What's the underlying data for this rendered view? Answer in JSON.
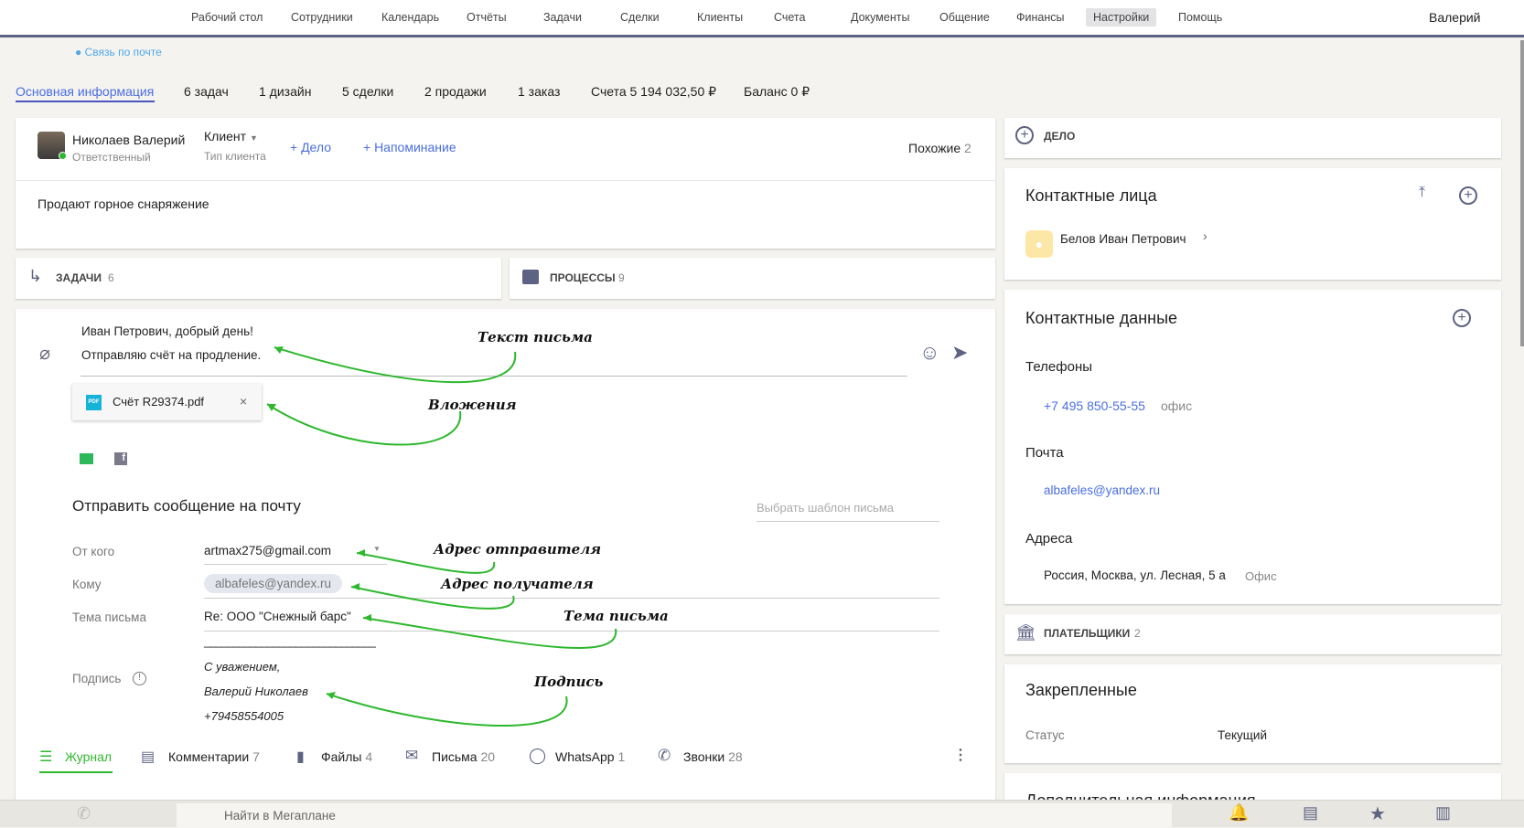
{
  "nav": {
    "items": [
      "Рабочий стол",
      "Сотрудники",
      "Календарь",
      "Отчёты",
      "Задачи",
      "Сделки",
      "Клиенты",
      "Счета",
      "Документы",
      "Общение",
      "Финансы",
      "Настройки",
      "Помощь"
    ],
    "active": "Настройки",
    "user": "Валерий"
  },
  "link_mail": "Связь по почте",
  "tabs": [
    "Основная информация",
    "6 задач",
    "1 дизайн",
    "5 сделки",
    "2 продажи",
    "1 заказ",
    "Счета 5 194 032,50 ₽",
    "Баланс 0 ₽"
  ],
  "client": {
    "name": "Николаев Валерий",
    "role": "Ответственный",
    "type": "Клиент",
    "type_label": "Тип клиента",
    "add_task": "+ Дело",
    "add_reminder": "+ Напоминание",
    "similar_label": "Похожие",
    "similar_count": "2",
    "description": "Продают горное снаряжение"
  },
  "tasks": {
    "label": "ЗАДАЧИ",
    "count": "6"
  },
  "processes": {
    "label": "ПРОЦЕССЫ",
    "count": "9"
  },
  "email": {
    "body_line1": "Иван Петрович, добрый день!",
    "body_line2": "Отправляю счёт на продление.",
    "attachment": "Счёт R29374.pdf",
    "title": "Отправить сообщение на почту",
    "template_placeholder": "Выбрать шаблон письма",
    "from_label": "От кого",
    "from": "artmax275@gmail.com",
    "to_label": "Кому",
    "to": "albafeles@yandex.ru",
    "subject_label": "Тема письма",
    "subject": "Re: ООО \"Снежный барс\"",
    "separator": "______________________________",
    "sign_label": "Подпись",
    "sign1": "С уважением,",
    "sign2": "Валерий Николаев",
    "sign3": "+79458554005"
  },
  "annotations": {
    "body": "Текст письма",
    "attach": "Вложения",
    "from": "Адрес отправителя",
    "to": "Адрес получателя",
    "subject": "Тема письма",
    "sign": "Подпись"
  },
  "feed_tabs": [
    {
      "label": "Журнал",
      "count": ""
    },
    {
      "label": "Комментарии",
      "count": "7"
    },
    {
      "label": "Файлы",
      "count": "4"
    },
    {
      "label": "Письма",
      "count": "20"
    },
    {
      "label": "WhatsApp",
      "count": "1"
    },
    {
      "label": "Звонки",
      "count": "28"
    }
  ],
  "right": {
    "deal": "ДЕЛО",
    "contacts_title": "Контактные лица",
    "contact": "Белов Иван Петрович",
    "data_title": "Контактные данные",
    "phones_label": "Телефоны",
    "phone": "+7 495 850-55-55",
    "phone_type": "офис",
    "mail_label": "Почта",
    "mail": "albafeles@yandex.ru",
    "addr_label": "Адреса",
    "addr": "Россия, Москва, ул. Лесная, 5 а",
    "addr_type": "Офис",
    "payers": "ПЛАТЕЛЬЩИКИ",
    "payers_count": "2",
    "pinned_title": "Закрепленные",
    "status_label": "Статус",
    "status": "Текущий",
    "extra_title": "Дополнительная информация"
  },
  "bottom": {
    "search_placeholder": "Найти в Мегаплане"
  },
  "colors": {
    "accent": "#4a6ee0",
    "nav_bar": "#5d6382",
    "green": "#2eb82e",
    "bg": "#f4f3ef"
  }
}
